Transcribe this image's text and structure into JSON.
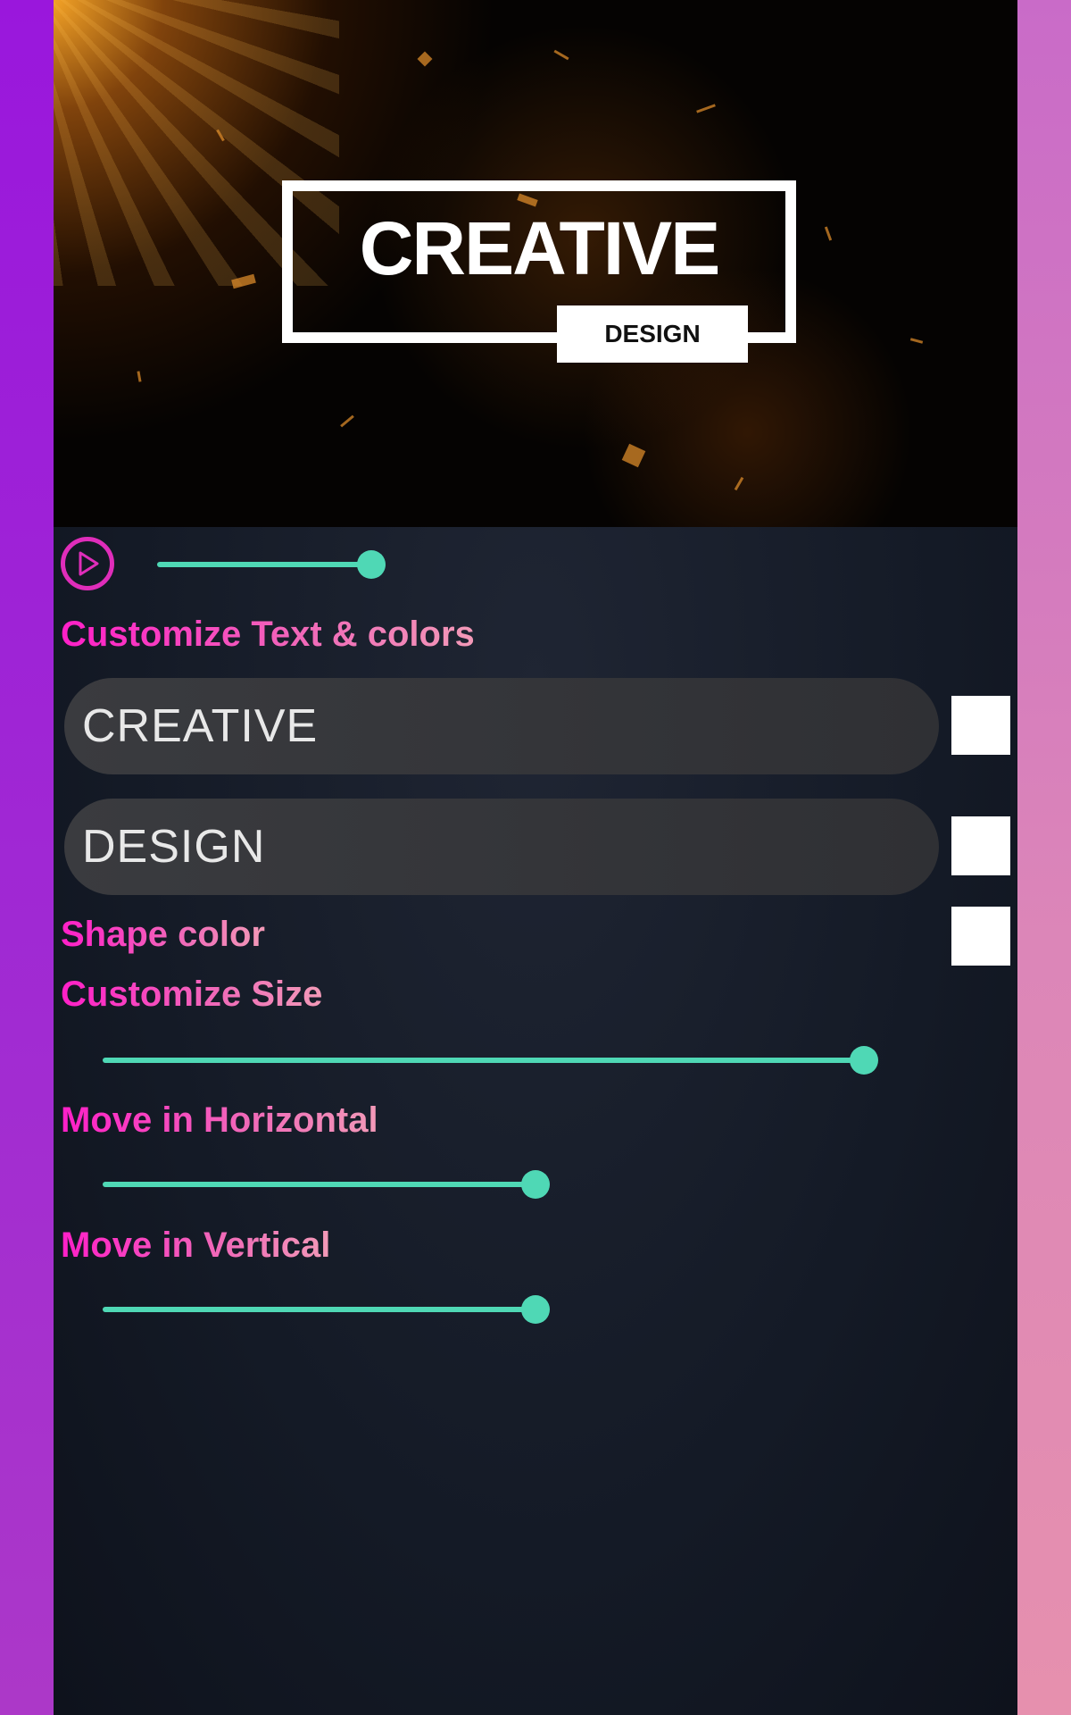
{
  "preview": {
    "title": "CREATIVE",
    "subtitle": "DESIGN"
  },
  "player": {
    "play_icon": "play-icon",
    "progress": 0.3
  },
  "customize_text": {
    "label": "Customize Text & colors",
    "fields": [
      {
        "value": "CREATIVE",
        "color": "#ffffff"
      },
      {
        "value": "DESIGN",
        "color": "#ffffff"
      }
    ]
  },
  "shape_color": {
    "label": "Shape color",
    "color": "#ffffff"
  },
  "customize_size": {
    "label": "Customize Size",
    "value": 1.0
  },
  "move_horizontal": {
    "label": "Move in Horizontal",
    "value": 0.5
  },
  "move_vertical": {
    "label": "Move in Vertical",
    "value": 0.5
  },
  "colors": {
    "accent": "#4fd8b5",
    "label_pink": "#ff1fc8"
  }
}
